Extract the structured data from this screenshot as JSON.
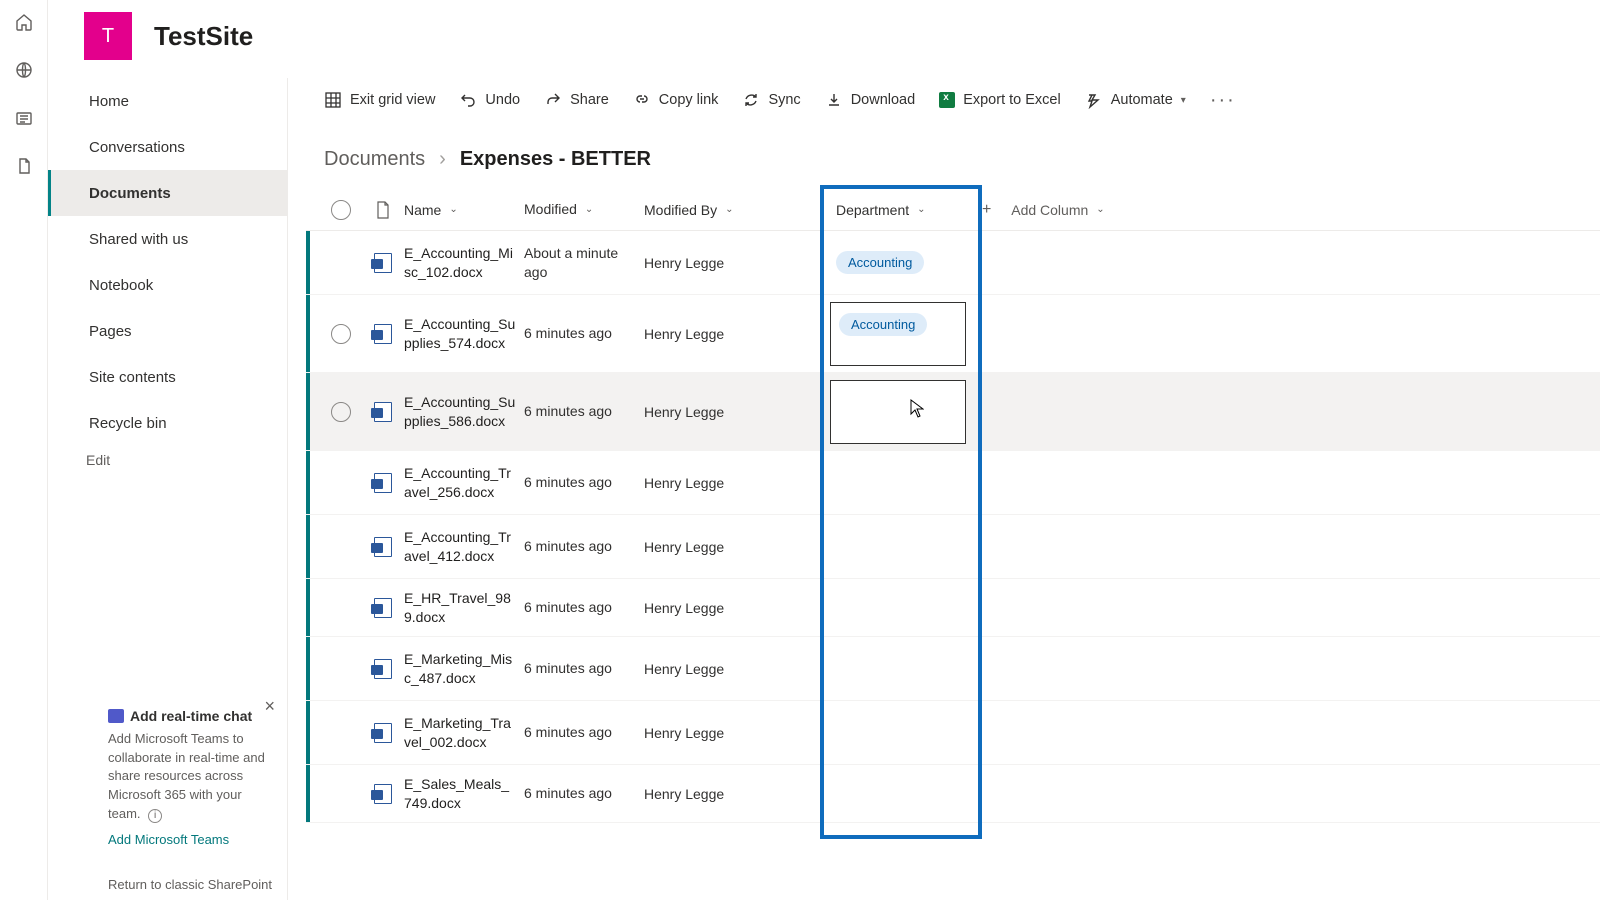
{
  "rail": {
    "icons": [
      "home",
      "globe",
      "news",
      "file"
    ]
  },
  "site": {
    "logo_letter": "T",
    "title": "TestSite"
  },
  "nav": {
    "items": [
      {
        "label": "Home"
      },
      {
        "label": "Conversations"
      },
      {
        "label": "Documents",
        "selected": true
      },
      {
        "label": "Shared with us"
      },
      {
        "label": "Notebook"
      },
      {
        "label": "Pages"
      },
      {
        "label": "Site contents"
      },
      {
        "label": "Recycle bin"
      }
    ],
    "edit_label": "Edit"
  },
  "chat_card": {
    "title": "Add real-time chat",
    "desc": "Add Microsoft Teams to collaborate in real-time and share resources across Microsoft 365 with your team.",
    "link": "Add Microsoft Teams"
  },
  "classic_link": "Return to classic SharePoint",
  "cmdbar": {
    "exit_grid": "Exit grid view",
    "undo": "Undo",
    "share": "Share",
    "copy_link": "Copy link",
    "sync": "Sync",
    "download": "Download",
    "export_excel": "Export to Excel",
    "automate": "Automate"
  },
  "breadcrumb": {
    "root": "Documents",
    "leaf": "Expenses - BETTER"
  },
  "columns": {
    "name": "Name",
    "modified": "Modified",
    "modified_by": "Modified By",
    "department": "Department",
    "add": "Add Column"
  },
  "rows": [
    {
      "name": "E_Accounting_Misc_102.docx",
      "modified": "About a minute ago",
      "modified_by": "Henry Legge",
      "dept": "Accounting",
      "show_sel": false
    },
    {
      "name": "E_Accounting_Supplies_574.docx",
      "modified": "6 minutes ago",
      "modified_by": "Henry Legge",
      "dept": "Accounting",
      "show_sel": true,
      "edit_box": true
    },
    {
      "name": "E_Accounting_Supplies_586.docx",
      "modified": "6 minutes ago",
      "modified_by": "Henry Legge",
      "dept": "",
      "show_sel": true,
      "edit_box": true,
      "hover": true
    },
    {
      "name": "E_Accounting_Travel_256.docx",
      "modified": "6 minutes ago",
      "modified_by": "Henry Legge",
      "dept": "",
      "show_sel": false
    },
    {
      "name": "E_Accounting_Travel_412.docx",
      "modified": "6 minutes ago",
      "modified_by": "Henry Legge",
      "dept": "",
      "show_sel": false
    },
    {
      "name": "E_HR_Travel_989.docx",
      "modified": "6 minutes ago",
      "modified_by": "Henry Legge",
      "dept": "",
      "show_sel": false
    },
    {
      "name": "E_Marketing_Misc_487.docx",
      "modified": "6 minutes ago",
      "modified_by": "Henry Legge",
      "dept": "",
      "show_sel": false
    },
    {
      "name": "E_Marketing_Travel_002.docx",
      "modified": "6 minutes ago",
      "modified_by": "Henry Legge",
      "dept": "",
      "show_sel": false
    },
    {
      "name": "E_Sales_Meals_749.docx",
      "modified": "6 minutes ago",
      "modified_by": "Henry Legge",
      "dept": "",
      "show_sel": false
    }
  ]
}
